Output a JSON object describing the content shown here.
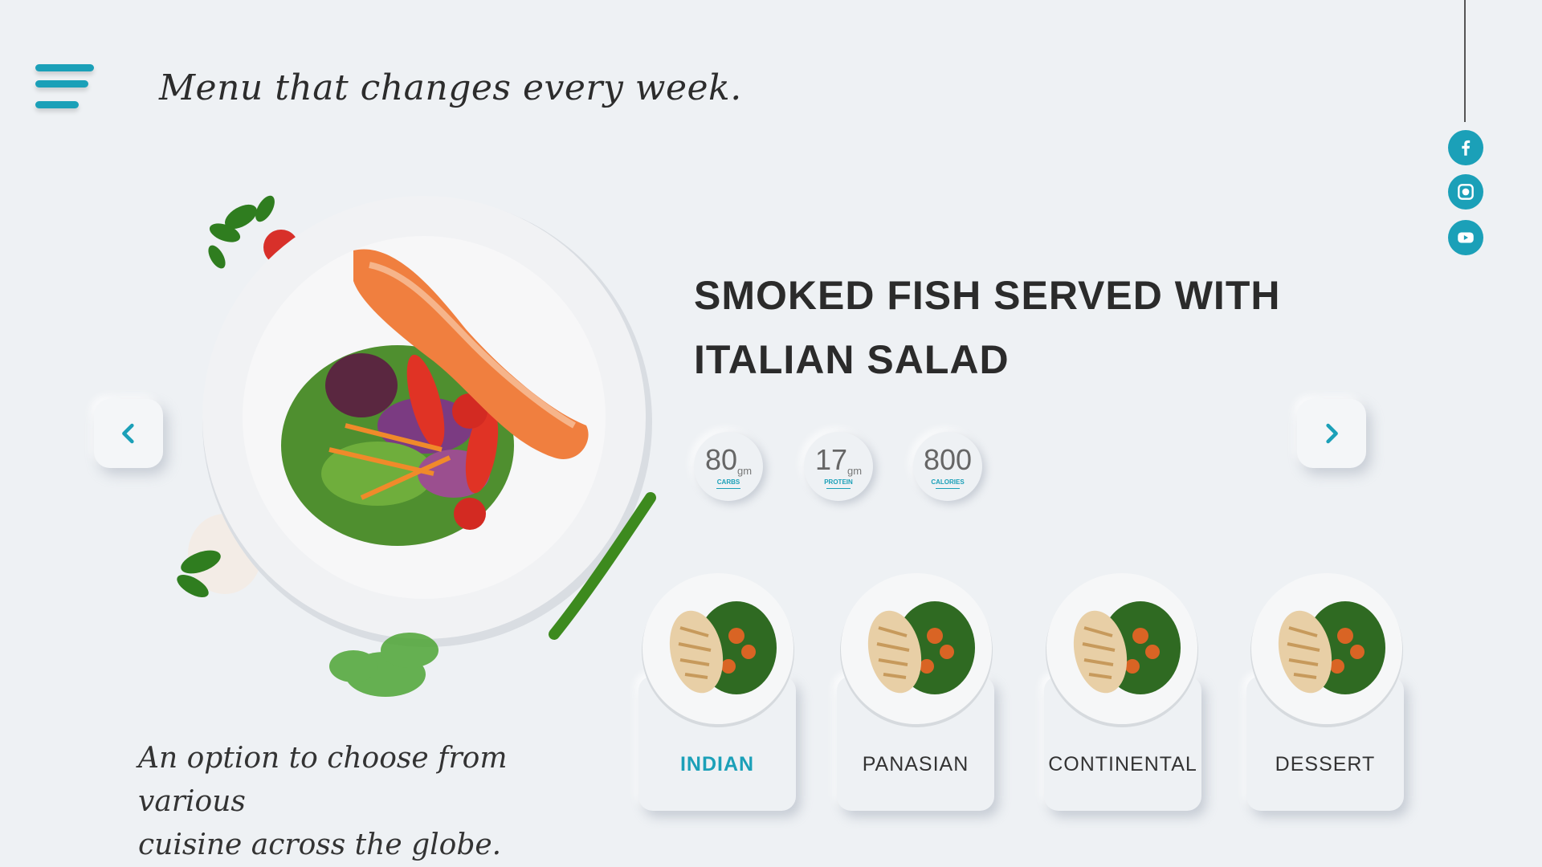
{
  "header": {
    "tagline": "Menu that changes every week."
  },
  "social": {
    "facebook_icon": "facebook-icon",
    "instagram_icon": "instagram-icon",
    "youtube_icon": "youtube-icon"
  },
  "dish": {
    "title_line1": "SMOKED FISH SERVED WITH",
    "title_line2": "ITALIAN SALAD"
  },
  "nutrition": [
    {
      "value": "80",
      "unit": "gm",
      "label": "CARBS"
    },
    {
      "value": "17",
      "unit": "gm",
      "label": "PROTEIN"
    },
    {
      "value": "800",
      "unit": "",
      "label": "CALORIES"
    }
  ],
  "description": {
    "line1": "An option to choose from various",
    "line2": "cuisine across the globe."
  },
  "cuisines": [
    {
      "label": "INDIAN",
      "active": true
    },
    {
      "label": "PANASIAN",
      "active": false
    },
    {
      "label": "CONTINENTAL",
      "active": false
    },
    {
      "label": "DESSERT",
      "active": false
    }
  ],
  "colors": {
    "accent": "#1ba0b8",
    "background": "#eef1f4"
  }
}
